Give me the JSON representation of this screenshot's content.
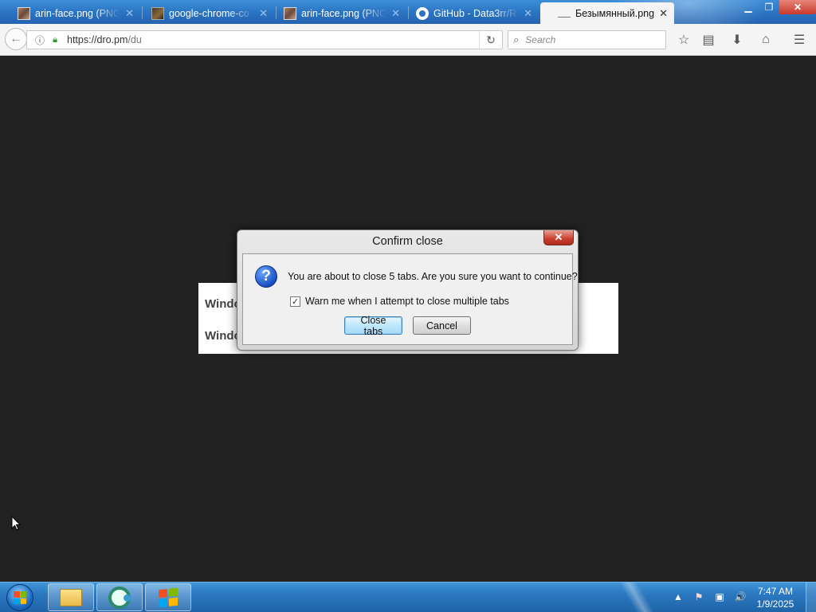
{
  "browser": {
    "tabs": [
      {
        "title": "arin-face.png (PNG",
        "icon": "image-thumbnail-icon",
        "close": "✕",
        "active": false
      },
      {
        "title": "google-chrome-co",
        "icon": "image-thumbnail-icon",
        "close": "✕",
        "active": false
      },
      {
        "title": "arin-face.png (PNG",
        "icon": "image-thumbnail-icon",
        "close": "✕",
        "active": false
      },
      {
        "title": "GitHub - Data3rr/R",
        "icon": "github-icon",
        "close": "✕",
        "active": false
      },
      {
        "title": "Безымянный.png",
        "icon": "blank-page-icon",
        "close": "✕",
        "active": true
      }
    ],
    "window_controls": {
      "minimize": "▁",
      "maximize": "❐",
      "close": "✕"
    },
    "url": {
      "host_part": "https://dro.pm",
      "path_part": "/du"
    },
    "search": {
      "placeholder": "Search"
    },
    "toolbar_icons": [
      "star-icon",
      "reading-list-icon",
      "download-icon",
      "home-icon",
      "menu-icon"
    ]
  },
  "page": {
    "lines": [
      "Windo",
      "Windo"
    ]
  },
  "dialog": {
    "title": "Confirm close",
    "close_glyph": "✕",
    "icon": "question-icon",
    "icon_glyph": "?",
    "message": "You are about to close 5 tabs. Are you sure you want to continue?",
    "warn_checkbox": {
      "label": "Warn me when I attempt to close multiple tabs",
      "checked": true,
      "glyph": "✓"
    },
    "buttons": {
      "confirm": "Close tabs",
      "cancel": "Cancel"
    }
  },
  "taskbar": {
    "pinned": [
      "file-explorer-icon",
      "ccleaner-icon",
      "windows-flag-icon"
    ],
    "tray": {
      "chevron": "▲",
      "flag": "⚑",
      "network": "▣",
      "volume": "🔊"
    },
    "clock": {
      "time": "7:47 AM",
      "date": "1/9/2025"
    }
  },
  "colors": {
    "tabstrip": "#2a73c2",
    "content_bg": "#222222",
    "taskbar": "#2b78c0",
    "dialog_close": "#c93e2e"
  }
}
